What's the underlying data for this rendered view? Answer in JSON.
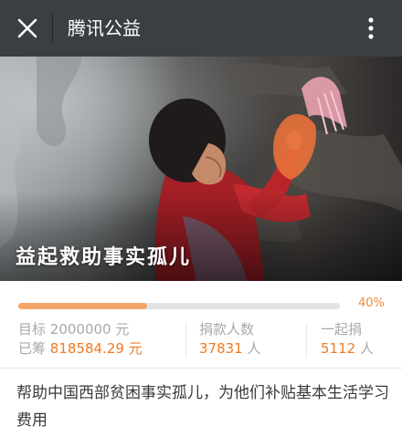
{
  "header": {
    "title": "腾讯公益",
    "close_icon": "close-icon",
    "more_icon": "more-vertical-icon"
  },
  "banner": {
    "title": "益起救助事实孤儿",
    "image": "child-holding-doll-photo"
  },
  "progress": {
    "fraction": 0.4,
    "percent_label": "40%"
  },
  "stats": {
    "goal_label": "目标",
    "goal_value": "2000000",
    "goal_unit": "元",
    "raised_label": "已筹",
    "raised_value": "818584.29",
    "raised_unit": "元",
    "donors_label": "捐款人数",
    "donors_value": "37831",
    "donors_unit": "人",
    "together_label": "一起捐",
    "together_value": "5112",
    "together_unit": "人"
  },
  "description": "帮助中国西部贫困事实孤儿，为他们补贴基本生活学习费用",
  "colors": {
    "accent": "#f07a22",
    "bar_fill": "#f5a56a",
    "topbar": "#3b3f44"
  }
}
